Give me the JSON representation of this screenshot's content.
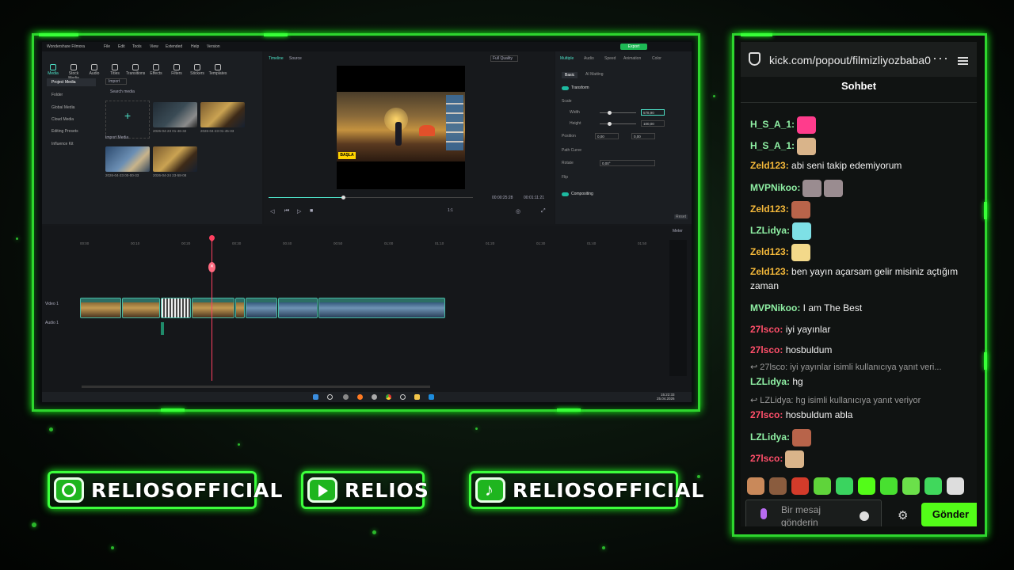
{
  "editor": {
    "app_title": "Wondershare Filmora",
    "menu": [
      "File",
      "Edit",
      "Tools",
      "View",
      "Extended",
      "Help",
      "Version"
    ],
    "export_label": "Export",
    "toolbar": [
      "Media",
      "Stock Media",
      "Audio",
      "Titles",
      "Transitions",
      "Effects",
      "Filters",
      "Stickers",
      "Templates"
    ],
    "sidebar": [
      "Project Media",
      "Folder",
      "Global Media",
      "Cloud Media",
      "Editing Presets",
      "Influence Kit"
    ],
    "import_dropdown": "Import",
    "search_placeholder": "Search media",
    "import_media_label": "Import Media",
    "thumbs": [
      "2026-04-23 01-46-32",
      "2026-04-23 01-45-33",
      "2026-04-23 00-00-33",
      "2026-04-24 23-58-08"
    ],
    "preview_tabs": [
      "Timeline",
      "Source"
    ],
    "quality": "Full Quality",
    "game_button": "BAŞLA",
    "time_current": "00:00:25:28",
    "time_total": "00:01:11:21",
    "zoom_ratio": "1:1",
    "prop_tabs": [
      "Multiple",
      "Audio",
      "Speed",
      "Animation",
      "Color"
    ],
    "prop_subtabs": [
      "Basic",
      "AI Matting"
    ],
    "transform_label": "Transform",
    "scale_label": "Scale",
    "width_label": "Width",
    "height_label": "Height",
    "width_value": "578,90",
    "height_value": "100,00",
    "position_label": "Position",
    "pos_x": "0,00",
    "pos_y": "0,00",
    "path_curve_label": "Path Curve",
    "rotate_label": "Rotate",
    "rotate_value": "0,00°",
    "flip_label": "Flip",
    "compositing_label": "Compositing",
    "reset_label": "Reset",
    "meter_label": "Meter",
    "ruler": [
      "00:00",
      "00:10",
      "00:20",
      "00:30",
      "00:40",
      "00:50",
      "01:00",
      "01:10",
      "01:20",
      "01:30",
      "01:40",
      "01:50"
    ],
    "track_video": "Video 1",
    "track_audio": "Audio 1",
    "taskbar_time": "15:22:33",
    "taskbar_date": "25.04.2026"
  },
  "chat": {
    "url": "kick.com/popout/filmizliyozbaba0",
    "title": "Sohbet",
    "colors": {
      "green": "#8ff0a4",
      "yellow": "#f5b93a",
      "red": "#ff4f6a",
      "accent": "#53fc18"
    },
    "messages": [
      {
        "user": "H_S_A_1",
        "text": "",
        "color": "green",
        "emotes": [
          "pink-emote"
        ]
      },
      {
        "user": "H_S_A_1",
        "text": "",
        "color": "green",
        "emotes": [
          "cat-emote"
        ]
      },
      {
        "user": "Zeld123",
        "text": "abi seni takip edemiyorum",
        "color": "yellow",
        "emotes": []
      },
      {
        "user": "MVPNikoo",
        "text": "",
        "color": "green",
        "emotes": [
          "hand-emote",
          "hand-emote"
        ]
      },
      {
        "user": "Zeld123",
        "text": "",
        "color": "yellow",
        "emotes": [
          "brick-emote"
        ]
      },
      {
        "user": "LZLidya",
        "text": "",
        "color": "green",
        "emotes": [
          "ghost-emote"
        ]
      },
      {
        "user": "Zeld123",
        "text": "",
        "color": "yellow",
        "emotes": [
          "blonde-emote"
        ]
      },
      {
        "user": "Zeld123",
        "text": "ben yayın açarsam gelir misiniz açtığım zaman",
        "color": "yellow",
        "emotes": []
      },
      {
        "user": "MVPNikoo",
        "text": "I am The Best",
        "color": "green",
        "emotes": []
      },
      {
        "user": "27lsco",
        "text": "iyi yayınlar",
        "color": "red",
        "emotes": []
      },
      {
        "user": "27lsco",
        "text": "hosbuldum",
        "color": "red",
        "emotes": []
      },
      {
        "user": "LZLidya",
        "text": "hg",
        "color": "green",
        "emotes": [],
        "reply": "27lsco: iyi yayınlar isimli kullanıcıya yanıt veri..."
      },
      {
        "user": "27lsco",
        "text": "hosbuldum abla",
        "color": "red",
        "emotes": [],
        "reply": "LZLidya: hg isimli kullanıcıya yanıt veriyor"
      },
      {
        "user": "LZLidya",
        "text": "",
        "color": "green",
        "emotes": [
          "brick-emote"
        ]
      },
      {
        "user": "27lsco",
        "text": "",
        "color": "red",
        "emotes": [
          "cat-emote"
        ]
      }
    ],
    "input_placeholder": "Bir mesaj gönderin",
    "send_label": "Gönder"
  },
  "socials": [
    {
      "icon": "instagram-icon",
      "handle": "RELIOSOFFICIAL"
    },
    {
      "icon": "youtube-icon",
      "handle": "RELIOS"
    },
    {
      "icon": "tiktok-icon",
      "handle": "RELIOSOFFICIAL"
    }
  ]
}
